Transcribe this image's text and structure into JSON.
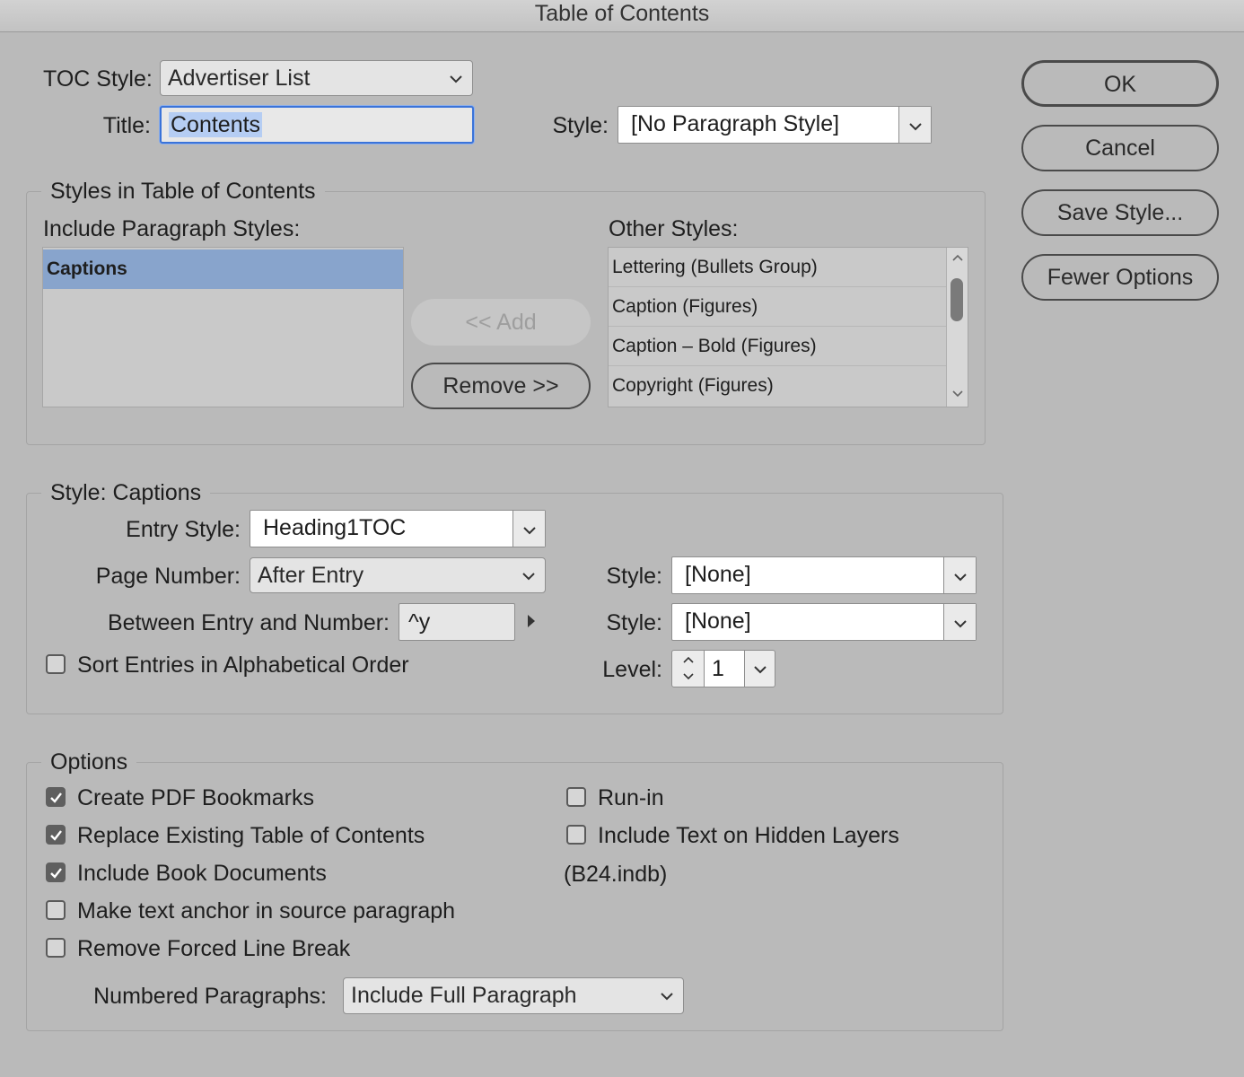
{
  "window": {
    "title": "Table of Contents"
  },
  "top": {
    "toc_style_label": "TOC Style:",
    "toc_style_value": "Advertiser List",
    "title_label": "Title:",
    "title_value": "Contents",
    "style_label": "Style:",
    "style_value": "[No Paragraph Style]"
  },
  "buttons": {
    "ok": "OK",
    "cancel": "Cancel",
    "save_style": "Save Style...",
    "fewer_options": "Fewer Options",
    "add": "<< Add",
    "remove": "Remove >>"
  },
  "styles_group": {
    "legend": "Styles in Table of Contents",
    "include_label": "Include Paragraph Styles:",
    "included": [
      "Captions"
    ],
    "other_label": "Other Styles:",
    "other": [
      "Lettering (Bullets Group)",
      "Caption (Figures)",
      "Caption – Bold (Figures)",
      "Copyright (Figures)"
    ]
  },
  "style_captions": {
    "legend": "Style: Captions",
    "entry_style_label": "Entry Style:",
    "entry_style_value": "Heading1TOC",
    "page_number_label": "Page Number:",
    "page_number_value": "After Entry",
    "page_style_label": "Style:",
    "page_style_value": "[None]",
    "between_label": "Between Entry and Number:",
    "between_value": "^y",
    "between_style_label": "Style:",
    "between_style_value": "[None]",
    "sort_label": "Sort Entries in Alphabetical Order",
    "sort_checked": false,
    "level_label": "Level:",
    "level_value": "1"
  },
  "options": {
    "legend": "Options",
    "create_pdf_bookmarks": "Create PDF Bookmarks",
    "replace_existing": "Replace Existing Table of Contents",
    "include_book_docs": "Include Book Documents",
    "make_anchor": "Make text anchor in source paragraph",
    "remove_forced_break": "Remove Forced Line Break",
    "run_in": "Run-in",
    "include_hidden": "Include Text on Hidden Layers",
    "book_file": "(B24.indb)",
    "numbered_label": "Numbered Paragraphs:",
    "numbered_value": "Include Full Paragraph"
  },
  "colors": {
    "dialog_bg": "#bababa",
    "selection": "#88a4cc",
    "focus_ring": "#3a73d9"
  }
}
